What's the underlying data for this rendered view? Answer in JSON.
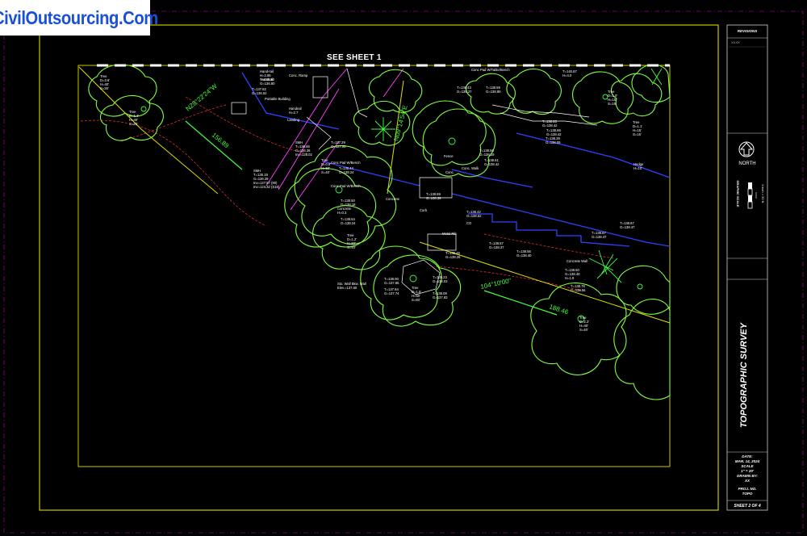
{
  "brand": {
    "logo_text": "CivilOutsourcing.Com",
    "logo_color": "#1a4fd6"
  },
  "sheet": {
    "see_sheet": "SEE SHEET 1",
    "title": "TOPOGRAPHIC SURVEY",
    "revisions_label": "REVISIONS",
    "revisions_entry": "XXXX",
    "north_label": "NORTH",
    "graphic_scale_label": "GRAPHIC SCALE",
    "scale_note": "1 inch = 20 ft.",
    "date_label": "DATE:",
    "date_value": "MAR. 14, 2024",
    "scale_label": "SCALE",
    "scale_value": "1\" = 20'",
    "drawn_by_label": "DRAWN BY:",
    "drawn_by_value": "XX",
    "proj_label": "PROJ. NO.",
    "proj_value": "TOPO",
    "sheet_number": "SHEET 2 OF 4"
  },
  "annotations": [
    {
      "text": "N28°22'24\"W",
      "kind": "bearing"
    },
    {
      "text": "156.89",
      "kind": "distance"
    },
    {
      "text": "N09°14'54\"E",
      "kind": "bearing"
    },
    {
      "text": "104°10'00\"",
      "kind": "bearing"
    },
    {
      "text": "188.46",
      "kind": "distance"
    },
    {
      "text": "Tree D=3.6' H=40' S=30'",
      "kind": "tree"
    },
    {
      "text": "Tree D=1.4' H=40' S=20'",
      "kind": "tree"
    },
    {
      "text": "Hand-rail H=2.85 T=136.40 G=136.80",
      "kind": "label"
    },
    {
      "text": "Conc. Ramp",
      "kind": "label"
    },
    {
      "text": "T=137.62 G=136.52",
      "kind": "elev"
    },
    {
      "text": "Portable Building",
      "kind": "label"
    },
    {
      "text": "Handrail H=2.7",
      "kind": "label"
    },
    {
      "text": "Landing",
      "kind": "label"
    },
    {
      "text": "Conc Pad W/Table/Bench",
      "kind": "label"
    },
    {
      "text": "T=138.43 G=138.27",
      "kind": "elev"
    },
    {
      "text": "T=138.59 G=138.80",
      "kind": "elev"
    },
    {
      "text": "T=140.87 H=4.0",
      "kind": "elev"
    },
    {
      "text": "SMH T=136.66 G=136.36 Inv=128.02",
      "kind": "label"
    },
    {
      "text": "SMH T=135.19 G=136.29 Inv=127.57 (90) Inv=124.32 (S18)",
      "kind": "label"
    },
    {
      "text": "T=137.29 G=137.00",
      "kind": "elev"
    },
    {
      "text": "Tree D=0.8' H=50' S=40'",
      "kind": "tree"
    },
    {
      "text": "Conc Pad W/Bench",
      "kind": "label"
    },
    {
      "text": "T=138.44 G=138.24",
      "kind": "elev"
    },
    {
      "text": "Conc Pad W/Bench",
      "kind": "label"
    },
    {
      "text": "T=138.50 G=138.18",
      "kind": "elev"
    },
    {
      "text": "Concrete H=0.3",
      "kind": "label"
    },
    {
      "text": "T=138.54 G=138.24",
      "kind": "elev"
    },
    {
      "text": "Tree D=1.2' H=50' S=40'",
      "kind": "tree"
    },
    {
      "text": "Sto. Wall Bkw. Wall Elev.=137.60",
      "kind": "label"
    },
    {
      "text": "T=138.00 G=137.85",
      "kind": "elev"
    },
    {
      "text": "T=137.94 G=137.74",
      "kind": "elev"
    },
    {
      "text": "Tree D=1.5' H=50' S=60'",
      "kind": "tree"
    },
    {
      "text": "T=138.09 G=137.83",
      "kind": "elev"
    },
    {
      "text": "T=138.23 G=138.03",
      "kind": "elev"
    },
    {
      "text": "T=138.46 G=138.26",
      "kind": "elev"
    },
    {
      "text": "T=138.42 G=138.52",
      "kind": "elev"
    },
    {
      "text": "T=138.57 G=138.37",
      "kind": "elev"
    },
    {
      "text": "T=138.56 G=138.40",
      "kind": "elev"
    },
    {
      "text": "T=138.69 G=138.39",
      "kind": "elev"
    },
    {
      "text": "T=138.67 G=138.47",
      "kind": "elev"
    },
    {
      "text": "T=138.67 G=138.47",
      "kind": "elev"
    },
    {
      "text": "T=138.76 G=138.56",
      "kind": "elev"
    },
    {
      "text": "Concrete Wall",
      "kind": "label"
    },
    {
      "text": "T=138.50 G=138.40 H=1.9",
      "kind": "elev"
    },
    {
      "text": "Tree D=2.2' H=40' S=40'",
      "kind": "tree"
    },
    {
      "text": "Tree D=1.1' H=15' S=15'",
      "kind": "tree"
    },
    {
      "text": "T=138.39 G=138.09",
      "kind": "elev"
    },
    {
      "text": "T=138.53 G=138.42",
      "kind": "elev"
    },
    {
      "text": "T=138.66 G=138.42",
      "kind": "elev"
    },
    {
      "text": "Hedge H=10'",
      "kind": "label"
    },
    {
      "text": "Tree D=1.0' H=15' S=15'",
      "kind": "tree"
    },
    {
      "text": "Handrail",
      "kind": "label"
    },
    {
      "text": "Fence",
      "kind": "label"
    },
    {
      "text": "Conc.",
      "kind": "label"
    },
    {
      "text": "Curb",
      "kind": "label"
    },
    {
      "text": "Conc. Walk",
      "kind": "label"
    },
    {
      "text": "Concrete",
      "kind": "label"
    },
    {
      "text": "Metal Rib",
      "kind": "label"
    },
    {
      "text": "CO",
      "kind": "label"
    },
    {
      "text": "T=138.61 G=138.42",
      "kind": "elev"
    },
    {
      "text": "T=138.50 G=138.19",
      "kind": "elev"
    }
  ],
  "colors": {
    "background": "#000000",
    "border": "#c8c800",
    "outer_dash": "#c000c0",
    "text": "#ffffff",
    "trees": "#80ff40",
    "road": "#3040ff",
    "contours": "#ff3030",
    "property_line": "#e0e000",
    "magenta_lines": "#ff40ff",
    "green_text": "#40ff40"
  }
}
